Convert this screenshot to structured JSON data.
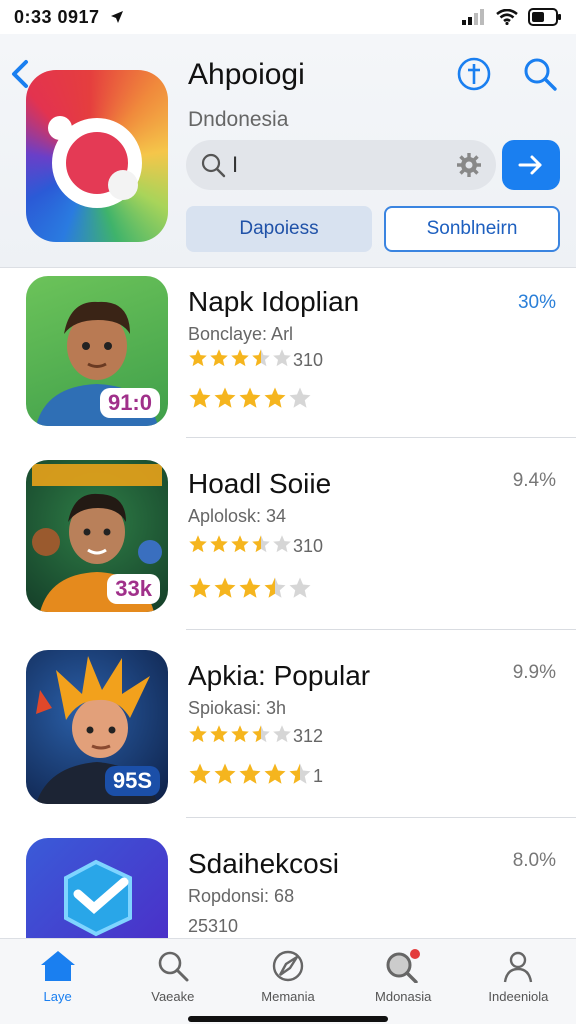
{
  "status_bar": {
    "time": "0:33 0917"
  },
  "header": {
    "title": "Ahpoiogi",
    "subtitle": "Dndonesia",
    "search_value": "I",
    "pill_primary": "Dapoiess",
    "pill_secondary": "Sonblneirn"
  },
  "apps": [
    {
      "name": "Napk Idoplian",
      "meta": "Bonclaye: Arl",
      "rating_text": "310",
      "stars": 3.5,
      "stars2": 4,
      "pct": "30%",
      "pct_blue": true,
      "badge": "91:0",
      "badge_color": "#a0308a"
    },
    {
      "name": "Hoadl Soiie",
      "meta": "Aplolosk: 34",
      "rating_text": "310",
      "stars": 3.5,
      "stars2": 3.5,
      "pct": "9.4%",
      "pct_blue": false,
      "badge": "33k",
      "badge_color": "#a0308a"
    },
    {
      "name": "Apkia: Popular",
      "meta": "Spiokasi: 3h",
      "rating_text": "312",
      "stars": 3.5,
      "stars2": 4.5,
      "pct": "9.9%",
      "pct_blue": false,
      "badge": "95S",
      "badge_color": "#1b3f8f",
      "stars2_suffix": "1"
    },
    {
      "name": "Sdaihekcosi",
      "meta": "Ropdonsi: 68",
      "rating_text": "",
      "stars": 0,
      "stars2": 0,
      "pct": "8.0%",
      "pct_blue": false,
      "badge": "",
      "extra": "25310"
    }
  ],
  "tabs": [
    {
      "label": "Laye",
      "icon": "home-icon",
      "active": true
    },
    {
      "label": "Vaeake",
      "icon": "search-icon",
      "active": false
    },
    {
      "label": "Memania",
      "icon": "compass-icon",
      "active": false
    },
    {
      "label": "Mdonasia",
      "icon": "search-badge-icon",
      "active": false
    },
    {
      "label": "Indeeniola",
      "icon": "person-icon",
      "active": false
    }
  ],
  "colors": {
    "accent": "#1a7ff0",
    "star": "#f5b51e"
  }
}
